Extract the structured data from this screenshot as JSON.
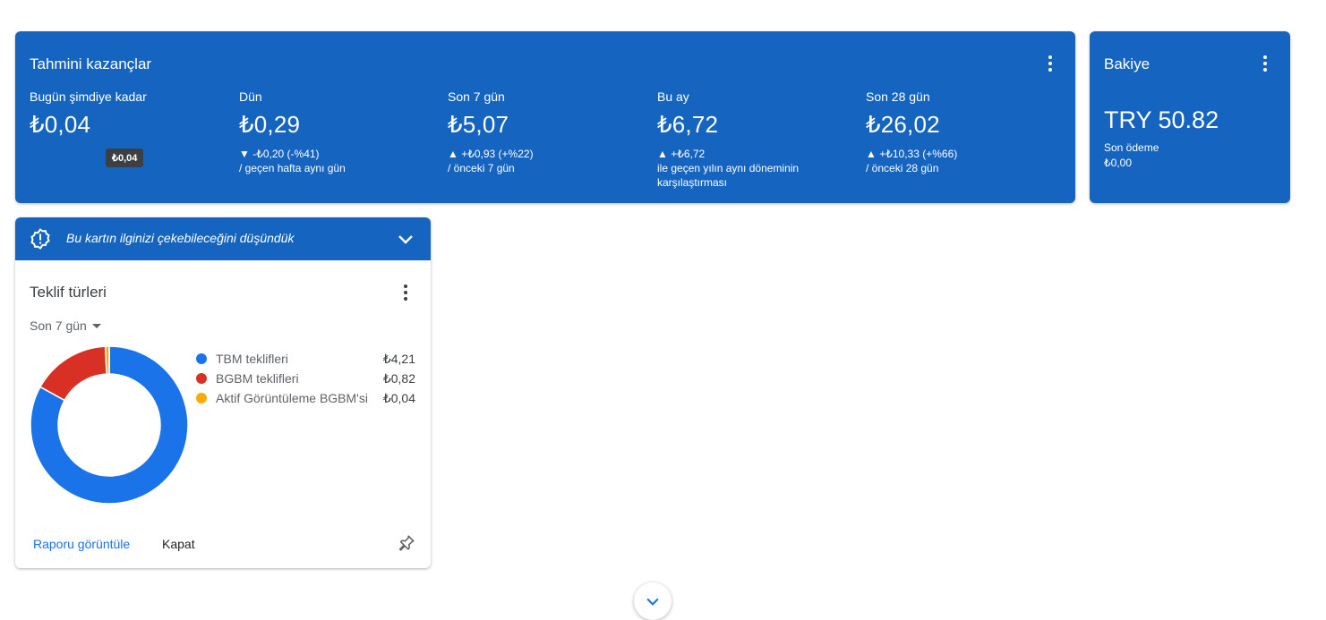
{
  "earnings": {
    "title": "Tahmini kazançlar",
    "metrics": [
      {
        "label": "Bugün şimdiye kadar",
        "value": "₺0,04",
        "change": "",
        "compare": ""
      },
      {
        "label": "Dün",
        "value": "₺0,29",
        "change": "▼ -₺0,20 (-%41)",
        "compare": "/ geçen hafta aynı gün"
      },
      {
        "label": "Son 7 gün",
        "value": "₺5,07",
        "change": "▲ +₺0,93 (+%22)",
        "compare": "/ önceki 7 gün"
      },
      {
        "label": "Bu ay",
        "value": "₺6,72",
        "change": "▲ +₺6,72",
        "compare": "ile geçen yılın aynı döneminin karşılaştırması"
      },
      {
        "label": "Son 28 gün",
        "value": "₺26,02",
        "change": "▲ +₺10,33 (+%66)",
        "compare": "/ önceki 28 gün"
      }
    ],
    "tooltip": "₺0,04"
  },
  "balance": {
    "title": "Bakiye",
    "value": "TRY 50.82",
    "last_payment_label": "Son ödeme",
    "last_payment_value": "₺0,00"
  },
  "suggestion": {
    "banner_text": "Bu kartın ilginizi çekebileceğini düşündük",
    "card_title": "Teklif türleri",
    "period": "Son 7 gün",
    "view_report": "Raporu görüntüle",
    "dismiss": "Kapat"
  },
  "chart_data": {
    "type": "pie",
    "series": [
      {
        "name": "TBM teklifleri",
        "label": "₺4,21",
        "value": 4.21,
        "color": "#1a73e8"
      },
      {
        "name": "BGBM teklifleri",
        "label": "₺0,82",
        "value": 0.82,
        "color": "#d93025"
      },
      {
        "name": "Aktif Görüntüleme BGBM'si",
        "label": "₺0,04",
        "value": 0.04,
        "color": "#f9ab00"
      }
    ]
  },
  "colors": {
    "primary": "#1565c0",
    "link": "#1a73e8"
  }
}
